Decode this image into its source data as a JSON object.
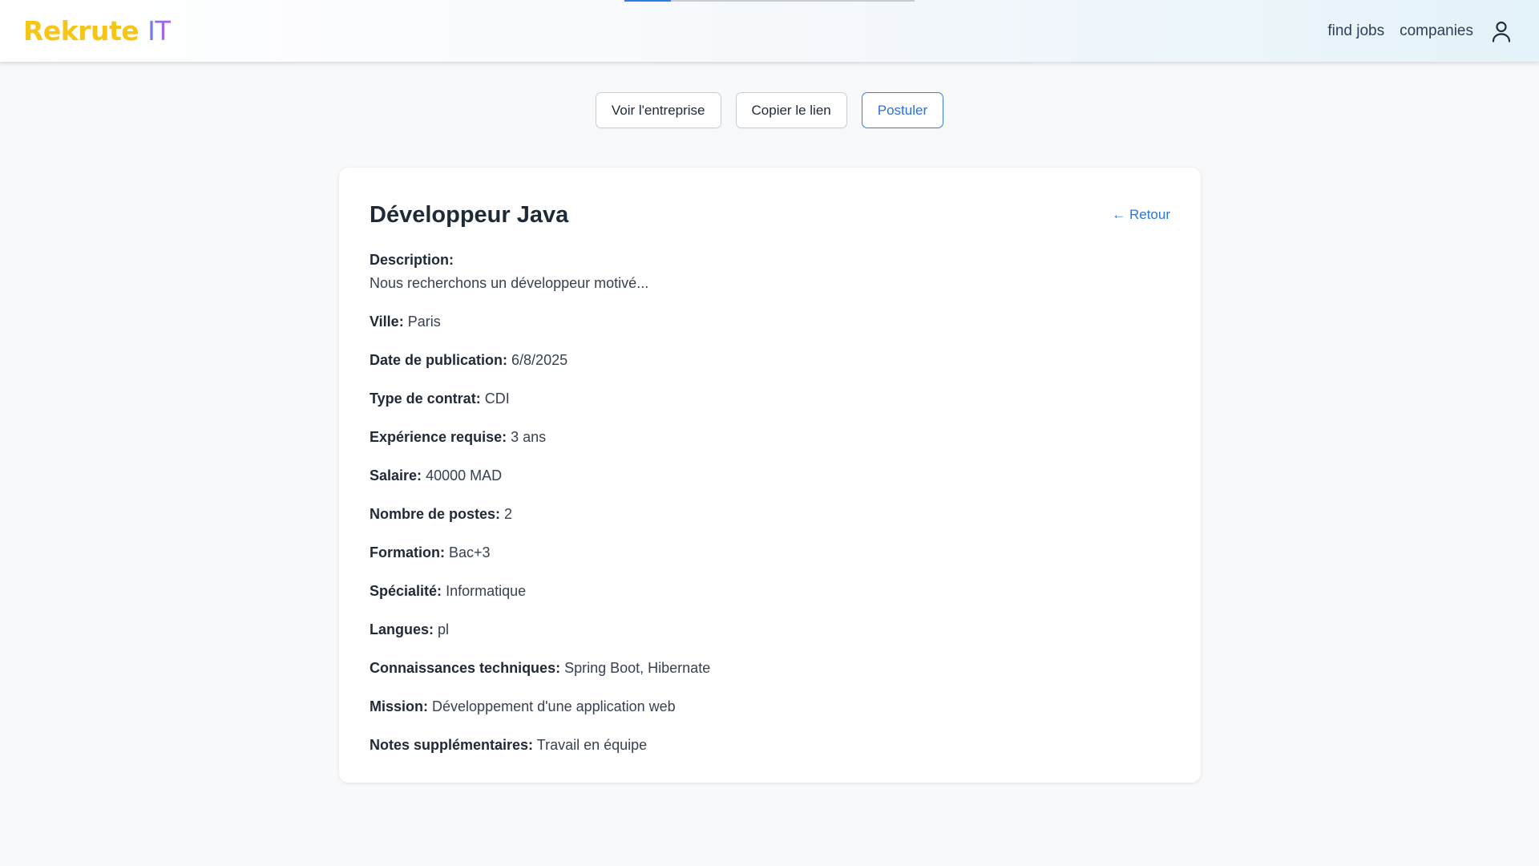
{
  "header": {
    "logo_part1": "Rekrute ",
    "logo_part2": "IT",
    "nav": {
      "find_jobs": "find jobs",
      "companies": "companies"
    },
    "user_icon": "user-icon",
    "progress_fraction": 0.16
  },
  "actions": {
    "view_company": "Voir l'entreprise",
    "copy_link": "Copier le lien",
    "apply": "Postuler"
  },
  "job": {
    "title": "Développeur Java",
    "back": "← Retour",
    "description_label": "Description:",
    "description": "Nous recherchons un développeur motivé...",
    "fields": [
      {
        "label": "Ville:",
        "value": "Paris"
      },
      {
        "label": "Date de publication:",
        "value": "6/8/2025"
      },
      {
        "label": "Type de contrat:",
        "value": "CDI"
      },
      {
        "label": "Expérience requise:",
        "value": "3 ans"
      },
      {
        "label": "Salaire:",
        "value": "40000 MAD"
      },
      {
        "label": "Nombre de postes:",
        "value": "2"
      },
      {
        "label": "Formation:",
        "value": "Bac+3"
      },
      {
        "label": "Spécialité:",
        "value": "Informatique"
      },
      {
        "label": "Langues:",
        "value": "pl"
      },
      {
        "label": "Connaissances techniques:",
        "value": "Spring Boot, Hibernate"
      },
      {
        "label": "Mission:",
        "value": "Développement d'une application web"
      },
      {
        "label": "Notes supplémentaires:",
        "value": "Travail en équipe"
      }
    ]
  },
  "colors": {
    "accent": "#2f74d8",
    "logo_yellow": "#f5c518",
    "logo_purple": "#b45ee0",
    "page_bg": "#f8f9fb"
  }
}
